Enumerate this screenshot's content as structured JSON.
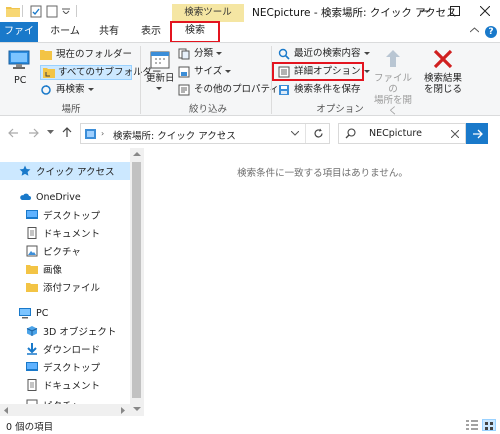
{
  "titlebar": {
    "context_tool": "検索ツール",
    "title": "NECpicture - 検索場所: クイック アクセス"
  },
  "tabs": {
    "file": "ファイル",
    "home": "ホーム",
    "share": "共有",
    "view": "表示",
    "search": "検索"
  },
  "ribbon": {
    "location": {
      "pc": "PC",
      "current_folder": "現在のフォルダー",
      "all_subfolders": "すべてのサブフォルダー",
      "search_again": "再検索",
      "group_label": "場所"
    },
    "refine": {
      "date_modified": "更新日",
      "kind": "分類",
      "size": "サイズ",
      "other_properties": "その他のプロパティ",
      "group_label": "絞り込み"
    },
    "options": {
      "recent_searches": "最近の検索内容",
      "advanced_options": "詳細オプション",
      "save_search": "検索条件を保存",
      "open_file_location": "ファイルの\n場所を開く",
      "close_search": "検索結果\nを閉じる",
      "group_label": "オプション"
    }
  },
  "address": {
    "path": "検索場所: クイック アクセス",
    "search_value": "NECpicture"
  },
  "navpane": {
    "quick_access": "クイック アクセス",
    "onedrive": "OneDrive",
    "onedrive_items": [
      "デスクトップ",
      "ドキュメント",
      "ピクチャ",
      "画像",
      "添付ファイル"
    ],
    "pc": "PC",
    "pc_items": [
      "3D オブジェクト",
      "ダウンロード",
      "デスクトップ",
      "ドキュメント",
      "ピクチャ"
    ]
  },
  "content": {
    "empty_message": "検索条件に一致する項目はありません。"
  },
  "status": {
    "item_count": "0 個の項目"
  },
  "colors": {
    "accent": "#1979ca",
    "highlight": "#e3141f",
    "selection": "#cce8ff",
    "context_tab": "#f5e6a3"
  }
}
